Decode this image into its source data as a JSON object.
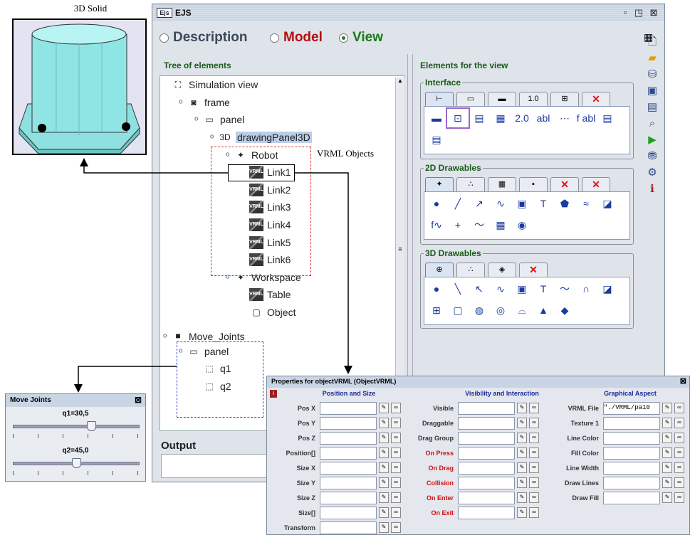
{
  "solid": {
    "caption": "3D Solid"
  },
  "window": {
    "logo": "Ejs",
    "title": "EJS",
    "controls": [
      "minimize-icon",
      "maximize-icon",
      "close-icon"
    ]
  },
  "modes": [
    {
      "label": "Description",
      "color": "#3a4a5a",
      "selected": false
    },
    {
      "label": "Model",
      "color": "#b01010",
      "selected": false
    },
    {
      "label": "View",
      "color": "#1a7a1a",
      "selected": true
    }
  ],
  "tree": {
    "title": "Tree of elements",
    "nodes": [
      {
        "label": "Simulation view",
        "depth": 0,
        "icon": "simulation-view-icon"
      },
      {
        "label": "frame",
        "depth": 1,
        "icon": "frame-icon"
      },
      {
        "label": "panel",
        "depth": 2,
        "icon": "panel-icon"
      },
      {
        "label": "drawingPanel3D",
        "depth": 3,
        "icon": "drawing-panel-3d-icon",
        "highlight": true
      },
      {
        "label": "Robot",
        "depth": 4,
        "icon": "group-icon"
      },
      {
        "label": "Link1",
        "depth": 5,
        "icon": "vrml-icon"
      },
      {
        "label": "Link2",
        "depth": 5,
        "icon": "vrml-icon"
      },
      {
        "label": "Link3",
        "depth": 5,
        "icon": "vrml-icon"
      },
      {
        "label": "Link4",
        "depth": 5,
        "icon": "vrml-icon"
      },
      {
        "label": "Link5",
        "depth": 5,
        "icon": "vrml-icon"
      },
      {
        "label": "Link6",
        "depth": 5,
        "icon": "vrml-icon"
      },
      {
        "label": "Workspace",
        "depth": 4,
        "icon": "group-icon"
      },
      {
        "label": "Table",
        "depth": 5,
        "icon": "vrml-icon"
      },
      {
        "label": "Object",
        "depth": 5,
        "icon": "cube-icon"
      },
      {
        "label": "Move_Joints",
        "depth": 0,
        "icon": "window-icon"
      },
      {
        "label": "panel",
        "depth": 1,
        "icon": "panel-icon"
      },
      {
        "label": "q1",
        "depth": 2,
        "icon": "slider-icon"
      },
      {
        "label": "q2",
        "depth": 2,
        "icon": "slider-icon"
      }
    ]
  },
  "annotation": {
    "vrml_label": "VRML Objects"
  },
  "output": {
    "label": "Output"
  },
  "elements": {
    "title": "Elements for the view",
    "groups": [
      {
        "title": "Interface",
        "tabs": [
          "⊢",
          "▭",
          "▬",
          "1.0",
          "⊞",
          "✕"
        ],
        "icons": [
          "▬",
          "⊡",
          "▤",
          "▦",
          "2.0",
          "abl",
          "⋯",
          "f abl",
          "▤",
          "▤"
        ]
      },
      {
        "title": "2D Drawables",
        "tabs": [
          "✦",
          "∴",
          "▦",
          "▪",
          "✕",
          "✕"
        ],
        "icons": [
          "●",
          "╱",
          "↗",
          "∿",
          "▣",
          "T",
          "⬟",
          "≈",
          "◪",
          "f∿",
          "+",
          "〜",
          "▦",
          "◉"
        ]
      },
      {
        "title": "3D Drawables",
        "tabs": [
          "⊕",
          "∴",
          "◈",
          "✕"
        ],
        "icons": [
          "●",
          "╲",
          "↖",
          "∿",
          "▣",
          "T",
          "〜",
          "∩",
          "◪",
          "⊞",
          "▢",
          "◍",
          "◎",
          "⌓",
          "▲",
          "◆"
        ]
      }
    ]
  },
  "move_joints": {
    "title": "Move Joints",
    "sliders": [
      {
        "label": "q1=30,5",
        "value": 0.62
      },
      {
        "label": "q2=45,0",
        "value": 0.5
      }
    ]
  },
  "properties": {
    "title": "Properties for objectVRML (ObjectVRML)",
    "columns": [
      {
        "header": "Position and Size",
        "rows": [
          {
            "label": "Pos X",
            "value": ""
          },
          {
            "label": "Pos Y",
            "value": ""
          },
          {
            "label": "Pos Z",
            "value": ""
          },
          {
            "label": "Position[]",
            "value": ""
          },
          {
            "label": "Size X",
            "value": ""
          },
          {
            "label": "Size Y",
            "value": ""
          },
          {
            "label": "Size Z",
            "value": ""
          },
          {
            "label": "Size[]",
            "value": ""
          },
          {
            "label": "Transform",
            "value": ""
          }
        ]
      },
      {
        "header": "Visibility and Interaction",
        "rows": [
          {
            "label": "Visible",
            "value": ""
          },
          {
            "label": "Draggable",
            "value": ""
          },
          {
            "label": "Drag Group",
            "value": ""
          },
          {
            "label": "On Press",
            "value": "",
            "red": true
          },
          {
            "label": "On Drag",
            "value": "",
            "red": true
          },
          {
            "label": "Collision",
            "value": "",
            "red": true
          },
          {
            "label": "On Enter",
            "value": "",
            "red": true
          },
          {
            "label": "On Exit",
            "value": "",
            "red": true
          }
        ]
      },
      {
        "header": "Graphical Aspect",
        "rows": [
          {
            "label": "VRML File",
            "value": "\"./VRML/pa10"
          },
          {
            "label": "Texture 1",
            "value": ""
          },
          {
            "label": "Line Color",
            "value": ""
          },
          {
            "label": "Fill Color",
            "value": ""
          },
          {
            "label": "Line Width",
            "value": ""
          },
          {
            "label": "Draw Lines",
            "value": ""
          },
          {
            "label": "Draw Fill",
            "value": ""
          }
        ]
      }
    ]
  }
}
